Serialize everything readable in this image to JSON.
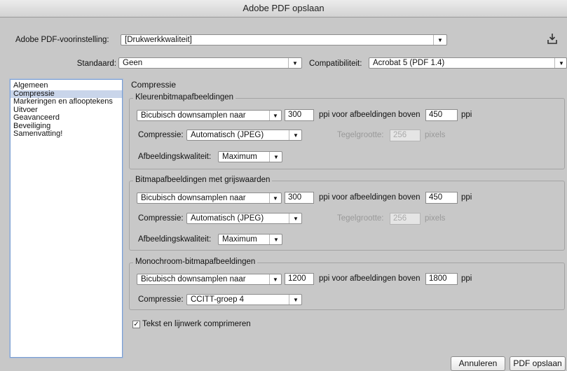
{
  "window_title": "Adobe PDF opslaan",
  "preset": {
    "label": "Adobe PDF-voorinstelling:",
    "value": "[Drukwerkkwaliteit]"
  },
  "standard": {
    "label": "Standaard:",
    "value": "Geen"
  },
  "compatibility": {
    "label": "Compatibiliteit:",
    "value": "Acrobat 5 (PDF 1.4)"
  },
  "sidebar": {
    "items": [
      "Algemeen",
      "Compressie",
      "Markeringen en aflooptekens",
      "Uitvoer",
      "Geavanceerd",
      "Beveiliging",
      "Samenvatting!"
    ],
    "selected_index": 1
  },
  "section_title": "Compressie",
  "color_group": {
    "title": "Kleurenbitmapafbeeldingen",
    "sampling": "Bicubisch downsamplen naar",
    "ppi": "300",
    "above_label": "ppi voor afbeeldingen boven",
    "above_value": "450",
    "ppi_suffix": "ppi",
    "compression_label": "Compressie:",
    "compression": "Automatisch (JPEG)",
    "tile_label": "Tegelgrootte:",
    "tile_value": "256",
    "tile_unit": "pixels",
    "quality_label": "Afbeeldingskwaliteit:",
    "quality": "Maximum"
  },
  "gray_group": {
    "title": "Bitmapafbeeldingen met grijswaarden",
    "sampling": "Bicubisch downsamplen naar",
    "ppi": "300",
    "above_label": "ppi voor afbeeldingen boven",
    "above_value": "450",
    "ppi_suffix": "ppi",
    "compression_label": "Compressie:",
    "compression": "Automatisch (JPEG)",
    "tile_label": "Tegelgrootte:",
    "tile_value": "256",
    "tile_unit": "pixels",
    "quality_label": "Afbeeldingskwaliteit:",
    "quality": "Maximum"
  },
  "mono_group": {
    "title": "Monochroom-bitmapafbeeldingen",
    "sampling": "Bicubisch downsamplen naar",
    "ppi": "1200",
    "above_label": "ppi voor afbeeldingen boven",
    "above_value": "1800",
    "ppi_suffix": "ppi",
    "compression_label": "Compressie:",
    "compression": "CCITT-groep 4"
  },
  "compress_text": {
    "label": "Tekst en lijnwerk comprimeren",
    "checked": true,
    "check_glyph": "✓"
  },
  "buttons": {
    "cancel": "Annuleren",
    "save": "PDF opslaan"
  },
  "icons": {
    "save_preset": "save-preset-icon",
    "dropdown": "▼"
  }
}
